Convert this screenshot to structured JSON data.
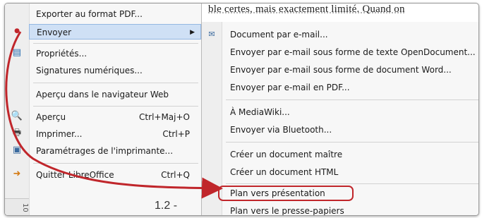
{
  "document": {
    "background_text": "ble certes, mais exactement limité. Quand on",
    "page_number": "1.2 -",
    "ruler_label": "10"
  },
  "file_menu": {
    "items": [
      {
        "label": "Exporter au format PDF...",
        "shortcut": ""
      },
      {
        "label": "Envoyer",
        "shortcut": ""
      },
      {
        "label": "Propriétés...",
        "shortcut": ""
      },
      {
        "label": "Signatures numériques...",
        "shortcut": ""
      },
      {
        "label": "Aperçu dans le navigateur Web",
        "shortcut": ""
      },
      {
        "label": "Aperçu",
        "shortcut": "Ctrl+Maj+O"
      },
      {
        "label": "Imprimer...",
        "shortcut": "Ctrl+P"
      },
      {
        "label": "Paramétrages de l'imprimante...",
        "shortcut": ""
      },
      {
        "label": "Quitter LibreOffice",
        "shortcut": "Ctrl+Q"
      }
    ]
  },
  "send_submenu": {
    "items": [
      {
        "label": "Document par e-mail..."
      },
      {
        "label": "Envoyer par e-mail sous forme de texte OpenDocument..."
      },
      {
        "label": "Envoyer par e-mail sous forme de document Word..."
      },
      {
        "label": "Envoyer par e-mail en PDF..."
      },
      {
        "label": "À MediaWiki..."
      },
      {
        "label": "Envoyer via Bluetooth..."
      },
      {
        "label": "Créer un document maître"
      },
      {
        "label": "Créer un document HTML"
      },
      {
        "label": "Plan vers présentation"
      },
      {
        "label": "Plan vers le presse-papiers"
      }
    ]
  },
  "colors": {
    "annotation": "#c0262b",
    "highlight": "#cfe0f5"
  }
}
